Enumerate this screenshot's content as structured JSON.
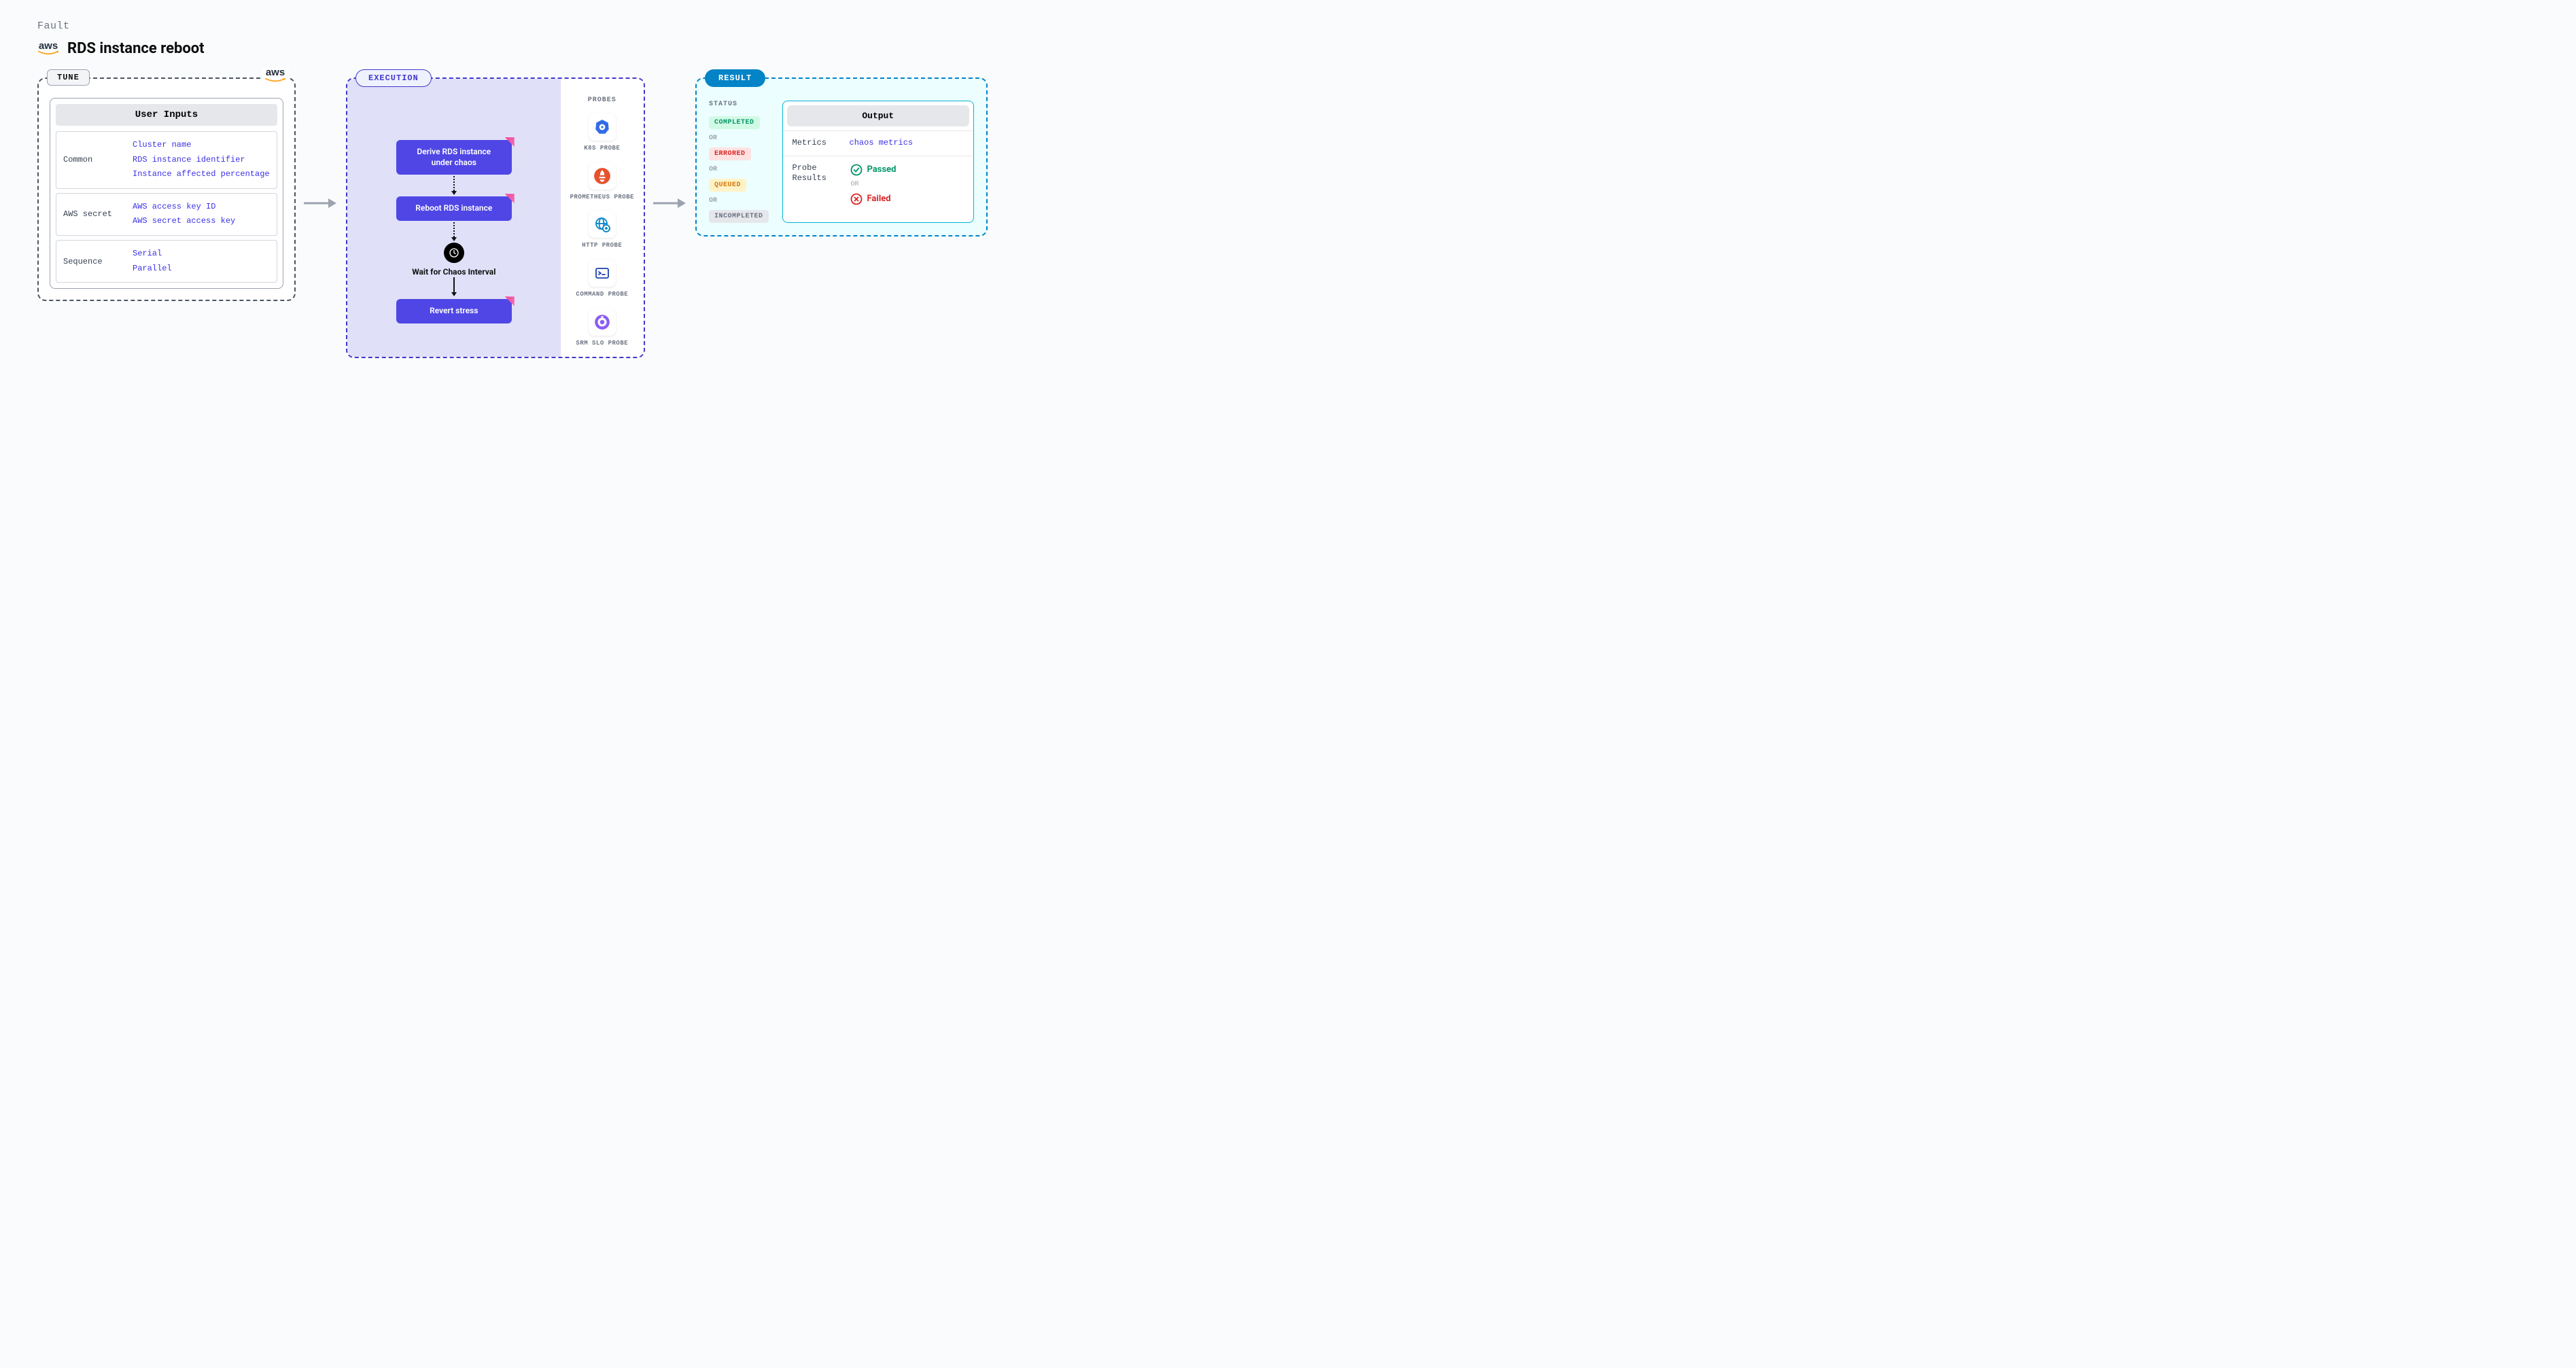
{
  "header": {
    "fault_label": "Fault",
    "title": "RDS instance reboot",
    "provider": "aws"
  },
  "tune": {
    "badge": "TUNE",
    "provider": "aws",
    "user_inputs_header": "User Inputs",
    "groups": [
      {
        "label": "Common",
        "values": [
          "Cluster name",
          "RDS instance identifier",
          "Instance affected percentage"
        ]
      },
      {
        "label": "AWS secret",
        "values": [
          "AWS access key ID",
          "AWS secret access key"
        ]
      },
      {
        "label": "Sequence",
        "values": [
          "Serial",
          "Parallel"
        ]
      }
    ]
  },
  "execution": {
    "badge": "EXECUTION",
    "steps": {
      "derive": "Derive RDS instance under chaos",
      "reboot": "Reboot RDS instance",
      "wait": "Wait for Chaos Interval",
      "revert": "Revert stress"
    },
    "probes_title": "PROBES",
    "probes": [
      {
        "label": "K8S PROBE",
        "icon": "kubernetes"
      },
      {
        "label": "PROMETHEUS PROBE",
        "icon": "prometheus"
      },
      {
        "label": "HTTP PROBE",
        "icon": "http"
      },
      {
        "label": "COMMAND PROBE",
        "icon": "command"
      },
      {
        "label": "SRM SLO PROBE",
        "icon": "srm"
      }
    ]
  },
  "result": {
    "badge": "RESULT",
    "status_title": "STATUS",
    "or_text": "OR",
    "statuses": {
      "completed": "COMPLETED",
      "errored": "ERRORED",
      "queued": "QUEUED",
      "incompleted": "INCOMPLETED"
    },
    "output": {
      "header": "Output",
      "metrics_label": "Metrics",
      "metrics_value": "chaos metrics",
      "probe_results_label": "Probe Results",
      "passed": "Passed",
      "failed": "Failed",
      "or": "OR"
    }
  }
}
